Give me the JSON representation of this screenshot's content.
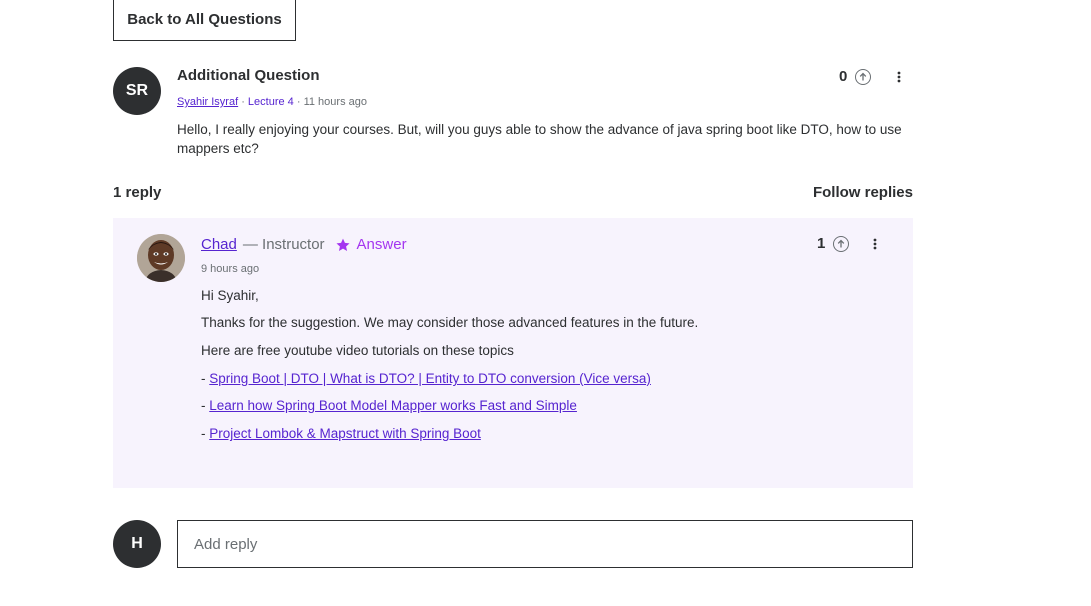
{
  "back_button": {
    "label": "Back to All Questions"
  },
  "question": {
    "avatar_initials": "SR",
    "title": "Additional Question",
    "author": "Syahir Isyraf",
    "separator": " · ",
    "lecture": "Lecture 4",
    "time": "11 hours ago",
    "body": "Hello, I really enjoying your courses. But, will you guys able to show the advance of java spring boot like DTO, how to use mappers etc?",
    "upvotes": "0"
  },
  "replies_header": {
    "count_label": "1 reply",
    "follow_label": "Follow replies"
  },
  "reply": {
    "author": "Chad",
    "role": "— Instructor",
    "badge": "Answer",
    "time": "9 hours ago",
    "upvotes": "1",
    "lines": [
      "Hi Syahir,",
      "Thanks for the suggestion. We may consider those advanced features in the future.",
      "Here are free youtube video tutorials on these topics"
    ],
    "link_prefix": "- ",
    "links": [
      "Spring Boot | DTO | What is DTO? | Entity to DTO conversion (Vice versa)",
      "Learn how Spring Boot Model Mapper works Fast and Simple",
      "Project Lombok & Mapstruct with Spring Boot"
    ]
  },
  "add_reply": {
    "avatar_initials": "H",
    "placeholder": "Add reply"
  },
  "colors": {
    "accent": "#5624d0",
    "badge": "#a435f0",
    "reply_bg": "#f7f3fd",
    "text": "#2d2f31",
    "muted": "#6a6f73"
  },
  "icons": {
    "upvote": "arrow-up-circle-icon",
    "more": "kebab-vertical-icon",
    "badge": "star-icon"
  }
}
